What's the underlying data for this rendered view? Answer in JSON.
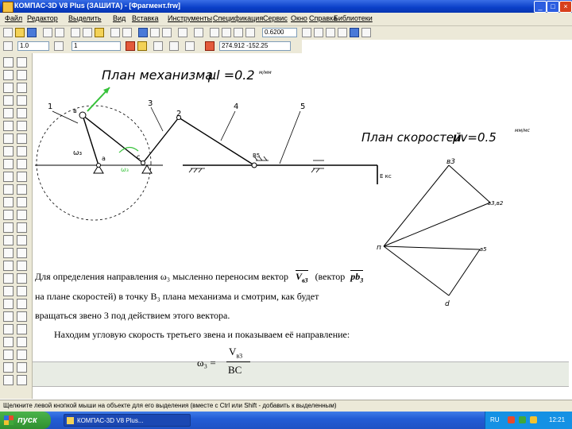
{
  "window": {
    "title": "КОМПАС-3D V8 Plus (ЗАШИТА) - [Фрагмент.frw]",
    "min_icon": "minimize-icon",
    "max_icon": "maximize-icon",
    "close_icon": "close-icon"
  },
  "menu": {
    "items": [
      "Файл",
      "Редактор",
      "Выделить",
      "Вид",
      "Вставка",
      "Инструменты",
      "Спецификация",
      "Сервис",
      "Окно",
      "Справка",
      "Библиотеки"
    ]
  },
  "toolbar": {
    "zoom_value": "0.6200",
    "layer_value": "1.0",
    "style_value": "1",
    "coords": "274.912 -152.25"
  },
  "drawing": {
    "mech_plan_title": "План механизма",
    "mech_scale_prefix": "μl =0.2",
    "mech_scale_unit": "м/мм",
    "vel_plan_title": "План скоростей",
    "vel_scale_prefix": "μv=0.5",
    "vel_scale_unit": "мм/мс",
    "links": [
      "1",
      "3",
      "2",
      "4",
      "5"
    ],
    "point_labels": {
      "a": "а",
      "b": "в",
      "c": "с",
      "a_lower": "А",
      "b5": "В5",
      "ekc": "Е кс",
      "omega": "ω₃",
      "v_label": "Vв"
    },
    "vel_labels": {
      "pole": "п",
      "a3": "в3",
      "v32": "в3,в2",
      "b5": "в5",
      "d": "d"
    }
  },
  "slide_text": {
    "line1_a": "Для определения направления ω₃ мысленно переносим вектор",
    "line1_vec": "V",
    "line1_sub": "в3",
    "line1_b": "(вектор",
    "line1_vec2": "pb",
    "line1_sub2": "3",
    "line1_c": ")",
    "line2": "на плане скоростей) в точку В₃ плана механизма и смотрим, как будет",
    "line3": "вращаться звено 3 под действием этого вектора.",
    "line4": "Находим угловую скорость третьего звена и показываем её направление:",
    "formula_lhs": "ω₃ =",
    "formula_num": "V",
    "formula_num_sub": "в3",
    "formula_den": "BC"
  },
  "status_bar": {
    "text": "Щелкните левой кнопкой мыши на объекте для его выделения (вместе с Ctrl или Shift - добавить к выделенным)"
  },
  "taskbar": {
    "start_label": "пуск",
    "item_label": "КОМПАС-3D V8 Plus...",
    "lang": "RU",
    "clock": "12:21"
  },
  "colors": {
    "titlebar": "#0a3fc8",
    "taskbar": "#235dd6",
    "accent_green": "#37c23a",
    "start_green": "#2f8f2f"
  }
}
